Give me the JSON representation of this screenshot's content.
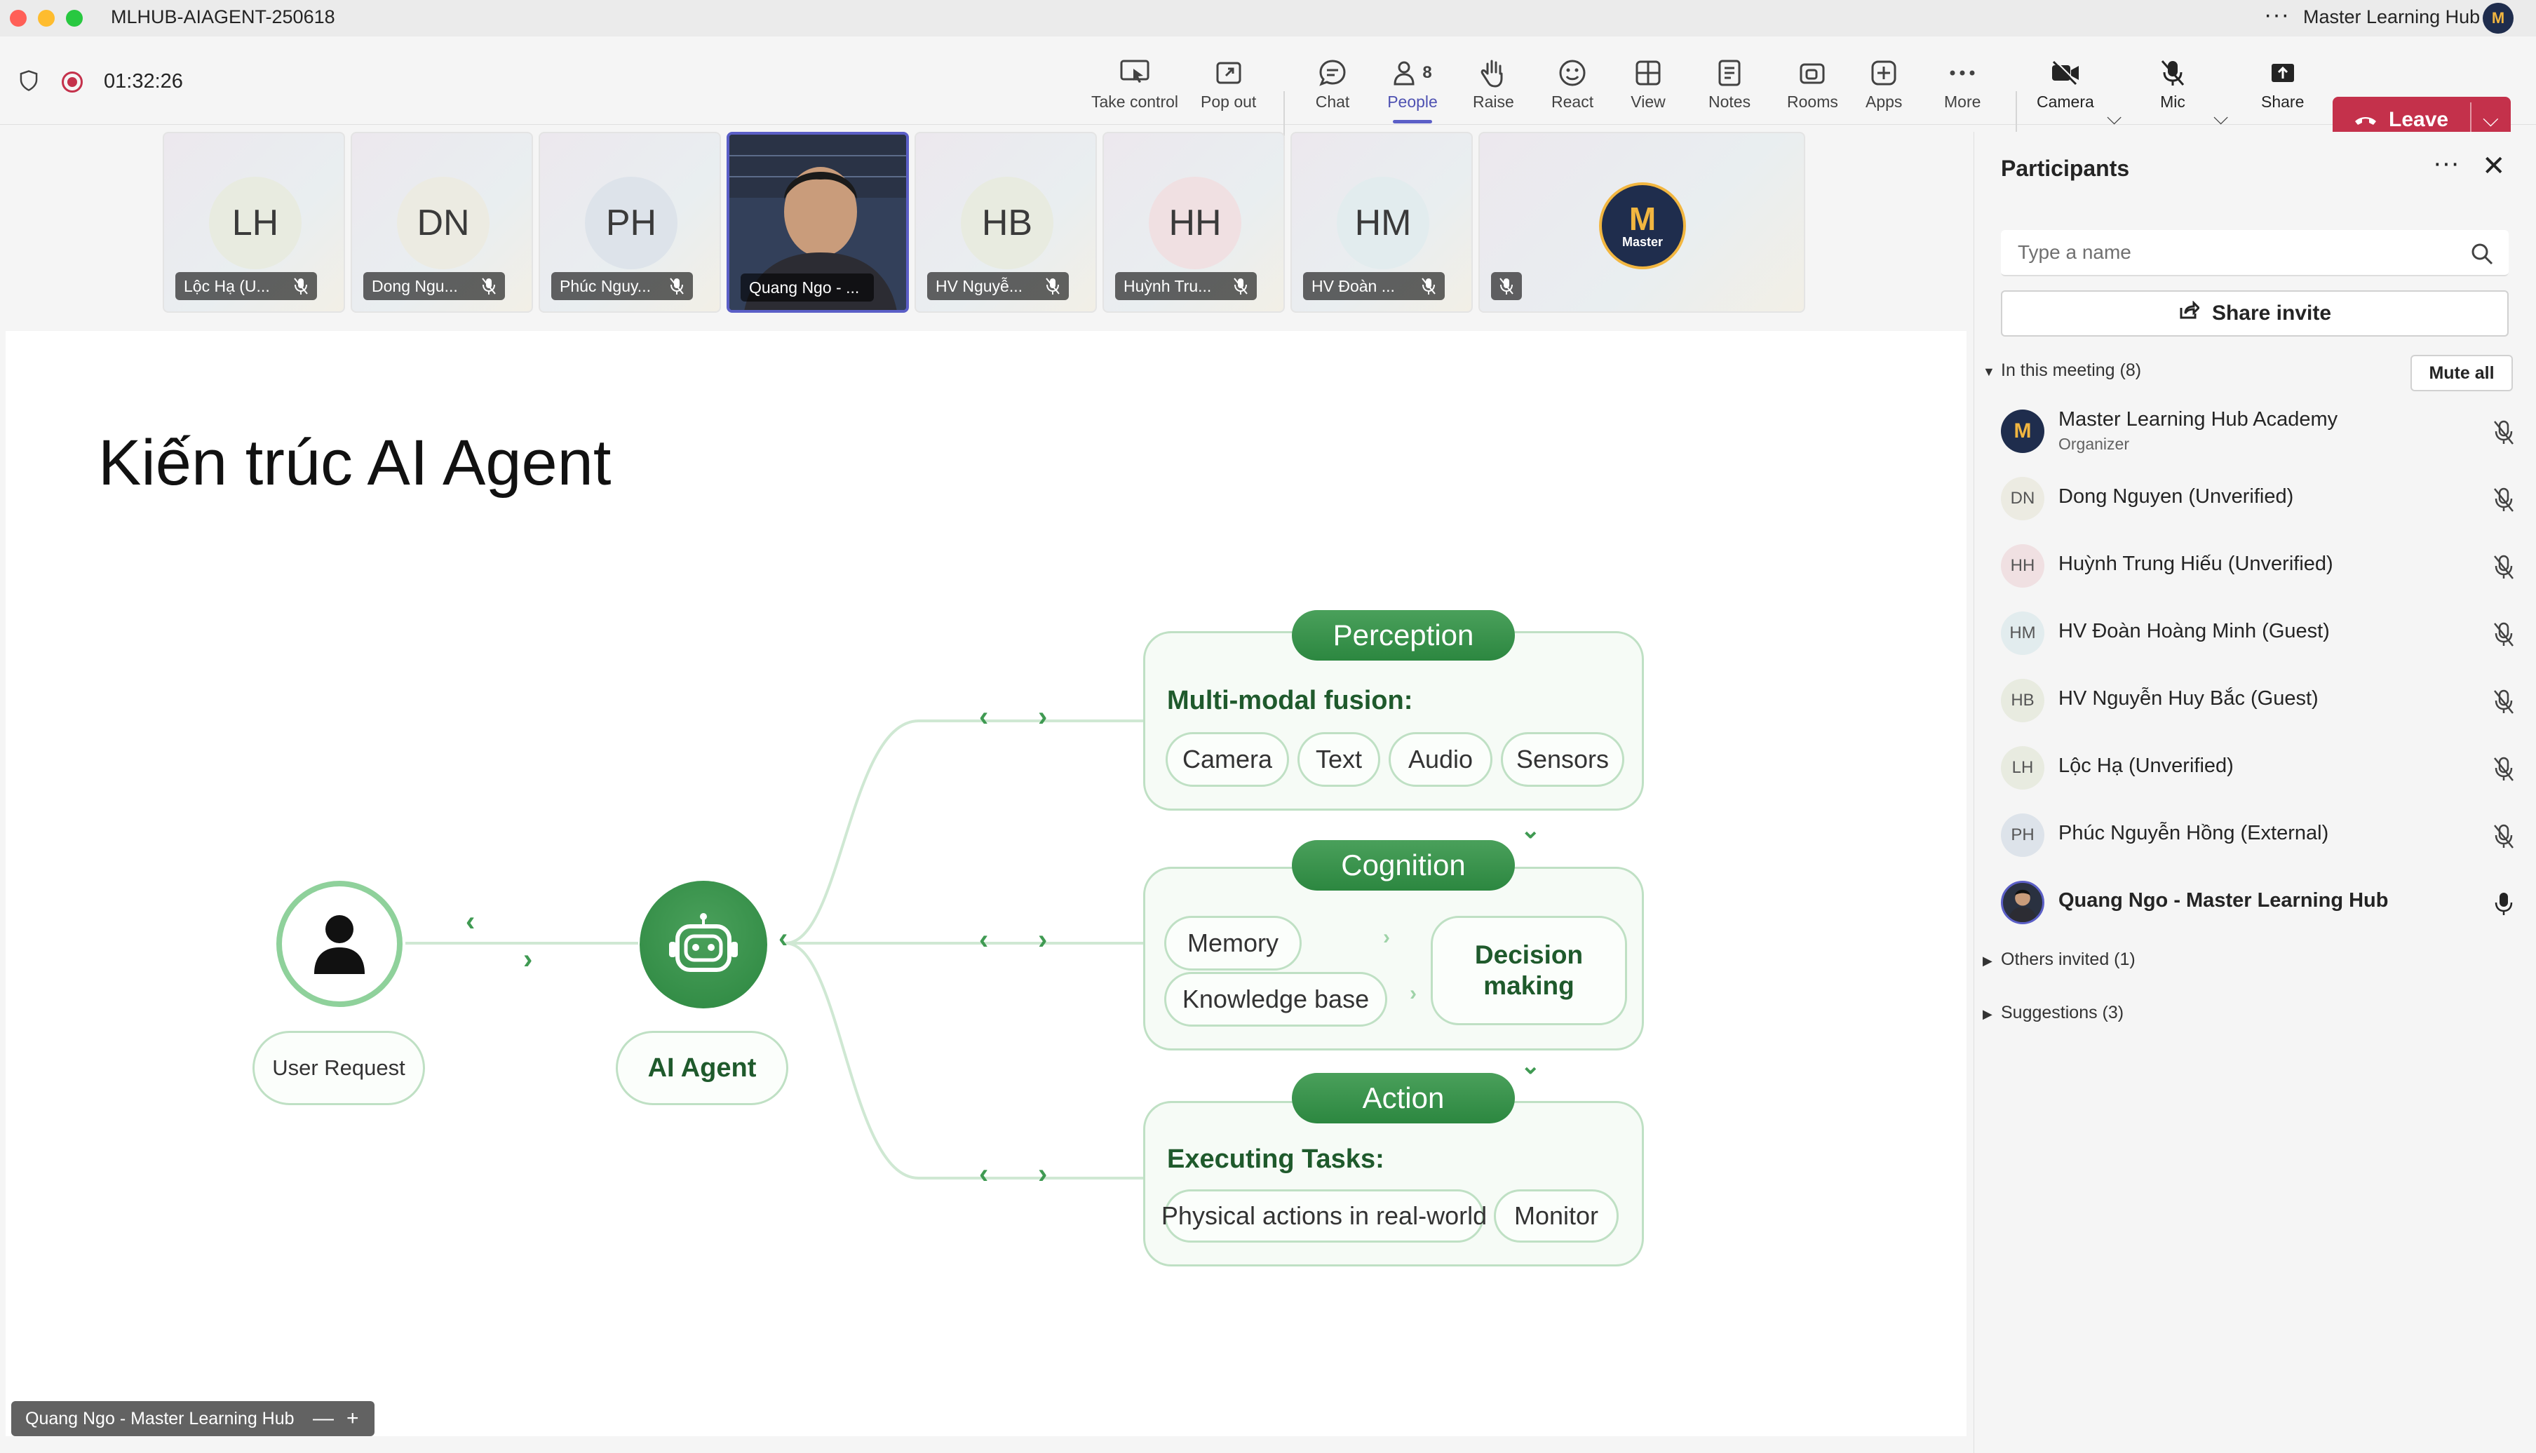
{
  "window": {
    "title": "MLHUB-AIAGENT-250618",
    "more_glyph": "···",
    "org_name": "Master Learning Hub",
    "org_avatar": "M"
  },
  "toolbar": {
    "timer": "01:32:26",
    "buttons": [
      {
        "label": "Take control",
        "icon": "take-control-icon"
      },
      {
        "label": "Pop out",
        "icon": "pop-out-icon"
      },
      {
        "label": "Chat",
        "icon": "chat-icon"
      },
      {
        "label": "People",
        "icon": "people-icon",
        "badge": "8",
        "active": true
      },
      {
        "label": "Raise",
        "icon": "raise-hand-icon"
      },
      {
        "label": "React",
        "icon": "react-icon"
      },
      {
        "label": "View",
        "icon": "view-icon"
      },
      {
        "label": "Notes",
        "icon": "notes-icon"
      },
      {
        "label": "Rooms",
        "icon": "rooms-icon"
      },
      {
        "label": "Apps",
        "icon": "apps-icon"
      },
      {
        "label": "More",
        "icon": "more-icon"
      },
      {
        "label": "Camera",
        "icon": "camera-off-icon"
      },
      {
        "label": "Mic",
        "icon": "mic-off-icon"
      },
      {
        "label": "Share",
        "icon": "share-icon"
      }
    ],
    "leave_label": "Leave"
  },
  "gallery": [
    {
      "initials": "LH",
      "name": "Lộc Hạ (U...",
      "bg": "#e8ebe0"
    },
    {
      "initials": "DN",
      "name": "Dong Ngu...",
      "bg": "#ecebe2"
    },
    {
      "initials": "PH",
      "name": "Phúc Nguy...",
      "bg": "#dde3ea"
    },
    {
      "initials": "",
      "name": "Quang Ngo - ...",
      "bg": "#2a3140"
    },
    {
      "initials": "HB",
      "name": "HV Nguyễ...",
      "bg": "#e8ebe0"
    },
    {
      "initials": "HH",
      "name": "Huỳnh Tru...",
      "bg": "#f0e0e2"
    },
    {
      "initials": "HM",
      "name": "HV Đoàn ...",
      "bg": "#e2ecee"
    },
    {
      "initials": "",
      "name": "",
      "bg": "#1f2d4d",
      "logo": "Master"
    }
  ],
  "slide": {
    "title": "Kiến trúc AI Agent",
    "user_request": "User Request",
    "ai_agent": "AI Agent",
    "perception": {
      "head": "Perception",
      "label": "Multi-modal fusion:",
      "items": [
        "Camera",
        "Text",
        "Audio",
        "Sensors"
      ]
    },
    "cognition": {
      "head": "Cognition",
      "memory": "Memory",
      "knowledge": "Knowledge base",
      "decision_1": "Decision",
      "decision_2": "making"
    },
    "action": {
      "head": "Action",
      "label": "Executing Tasks:",
      "items": [
        "Physical actions in real-world",
        "Monitor"
      ]
    }
  },
  "selfview": {
    "name": "Quang Ngo - Master Learning Hub",
    "minus": "—",
    "plus": "+"
  },
  "sidebar": {
    "title": "Participants",
    "more": "···",
    "close": "✕",
    "search_placeholder": "Type a name",
    "share_invite": "Share invite",
    "in_meeting": "In this meeting (8)",
    "mute_all": "Mute all",
    "participants": [
      {
        "initials": "M",
        "name": "Master Learning Hub Academy",
        "role": "Organizer",
        "bg": "#1f2d4d",
        "muted": true
      },
      {
        "initials": "DN",
        "name": "Dong Nguyen (Unverified)",
        "role": "",
        "bg": "#ecebe2",
        "muted": true
      },
      {
        "initials": "HH",
        "name": "Huỳnh Trung Hiếu (Unverified)",
        "role": "",
        "bg": "#f0e0e2",
        "muted": true
      },
      {
        "initials": "HM",
        "name": "HV Đoàn Hoàng Minh (Guest)",
        "role": "",
        "bg": "#e2ecee",
        "muted": true
      },
      {
        "initials": "HB",
        "name": "HV Nguyễn Huy Bắc (Guest)",
        "role": "",
        "bg": "#e8ebe0",
        "muted": true
      },
      {
        "initials": "LH",
        "name": "Lộc Hạ (Unverified)",
        "role": "",
        "bg": "#e8ebe0",
        "muted": true
      },
      {
        "initials": "PH",
        "name": "Phúc Nguyễn Hồng (External)",
        "role": "",
        "bg": "#dde3ea",
        "muted": true
      },
      {
        "initials": "",
        "name": "Quang Ngo - Master Learning Hub",
        "role": "",
        "bg": "#2a3140",
        "muted": false
      }
    ],
    "others_invited": "Others invited (1)",
    "suggestions": "Suggestions (3)"
  },
  "colors": {
    "accent": "#5b5fc7",
    "leave": "#c4314b",
    "slide_green": "#2c8740"
  }
}
